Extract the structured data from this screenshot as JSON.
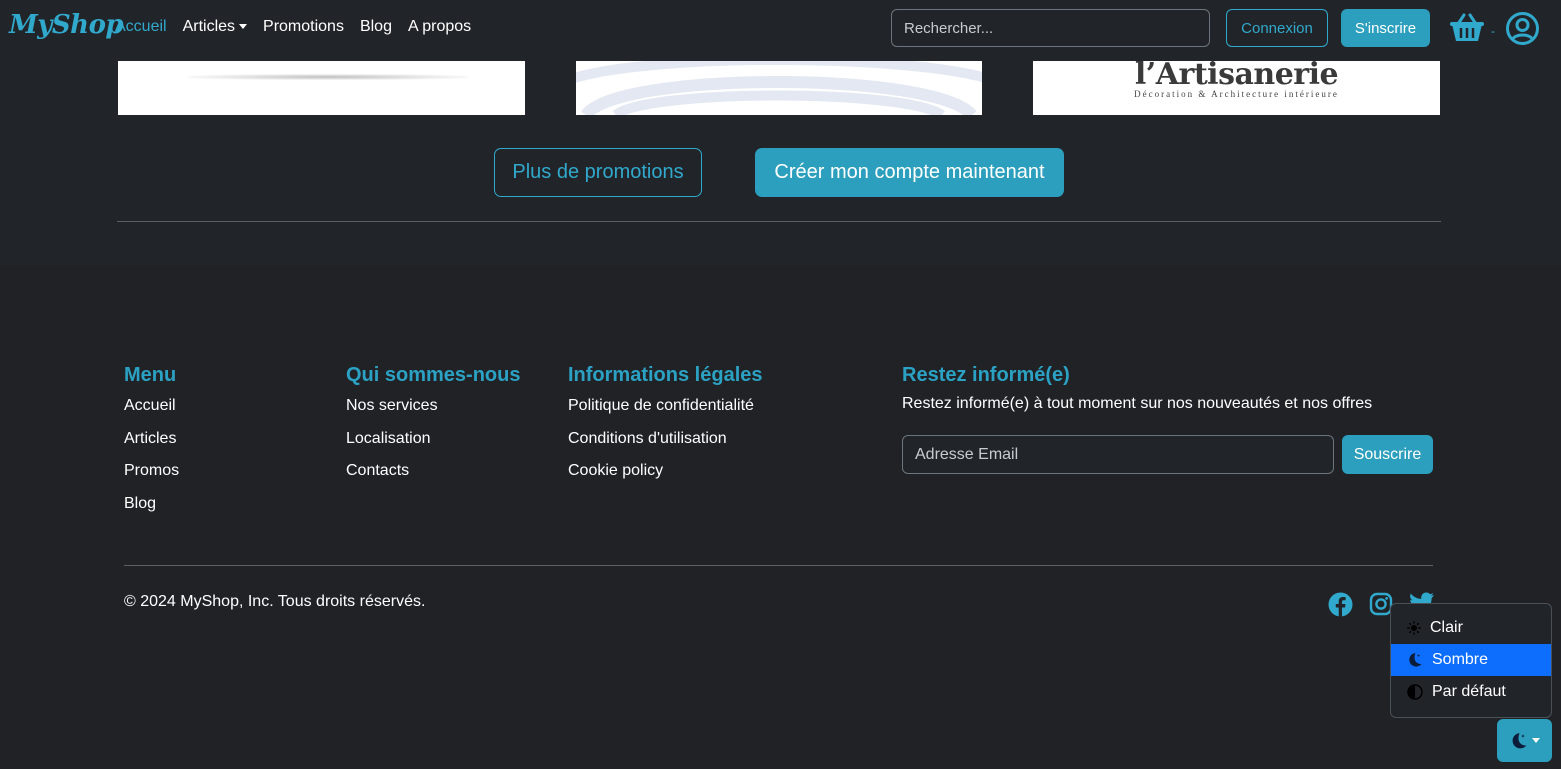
{
  "navbar": {
    "brand": "MyShop",
    "links": [
      {
        "label": "Accueil",
        "active": true
      },
      {
        "label": "Articles",
        "dropdown": true
      },
      {
        "label": "Promotions"
      },
      {
        "label": "Blog"
      },
      {
        "label": "A propos"
      }
    ],
    "search_placeholder": "Rechercher...",
    "login_label": "Connexion",
    "signup_label": "S'inscrire",
    "cart_count": "-",
    "icons": [
      "basket-icon",
      "user-circle-icon"
    ]
  },
  "promo_cards": {
    "card3_logo_text": "l’Artisanerie",
    "card3_logo_sub": "Décoration & Architecture intérieure"
  },
  "cta": {
    "more_promos": "Plus de promotions",
    "create_account": "Créer mon compte maintenant"
  },
  "footer": {
    "menu": {
      "title": "Menu",
      "links": [
        "Accueil",
        "Articles",
        "Promos",
        "Blog"
      ]
    },
    "about": {
      "title": "Qui sommes-nous",
      "links": [
        "Nos services",
        "Localisation",
        "Contacts"
      ]
    },
    "legal": {
      "title": "Informations légales",
      "links": [
        "Politique de confidentialité",
        "Conditions d'utilisation",
        "Cookie policy"
      ]
    },
    "newsletter": {
      "title": "Restez informé(e)",
      "text": "Restez informé(e) à tout moment sur nos nouveautés et nos offres",
      "email_placeholder": "Adresse Email",
      "subscribe_label": "Souscrire"
    },
    "copyright": "© 2024 MyShop, Inc. Tous droits réservés.",
    "social_icons": [
      "facebook-icon",
      "instagram-icon",
      "twitter-icon"
    ]
  },
  "theme_menu": {
    "items": [
      {
        "label": "Clair",
        "icon": "sun-icon"
      },
      {
        "label": "Sombre",
        "icon": "moon-icon",
        "active": true
      },
      {
        "label": "Par défaut",
        "icon": "contrast-icon"
      }
    ]
  },
  "colors": {
    "background": "#212529",
    "accent": "#31a9cc",
    "active_item": "#0d6efd"
  }
}
